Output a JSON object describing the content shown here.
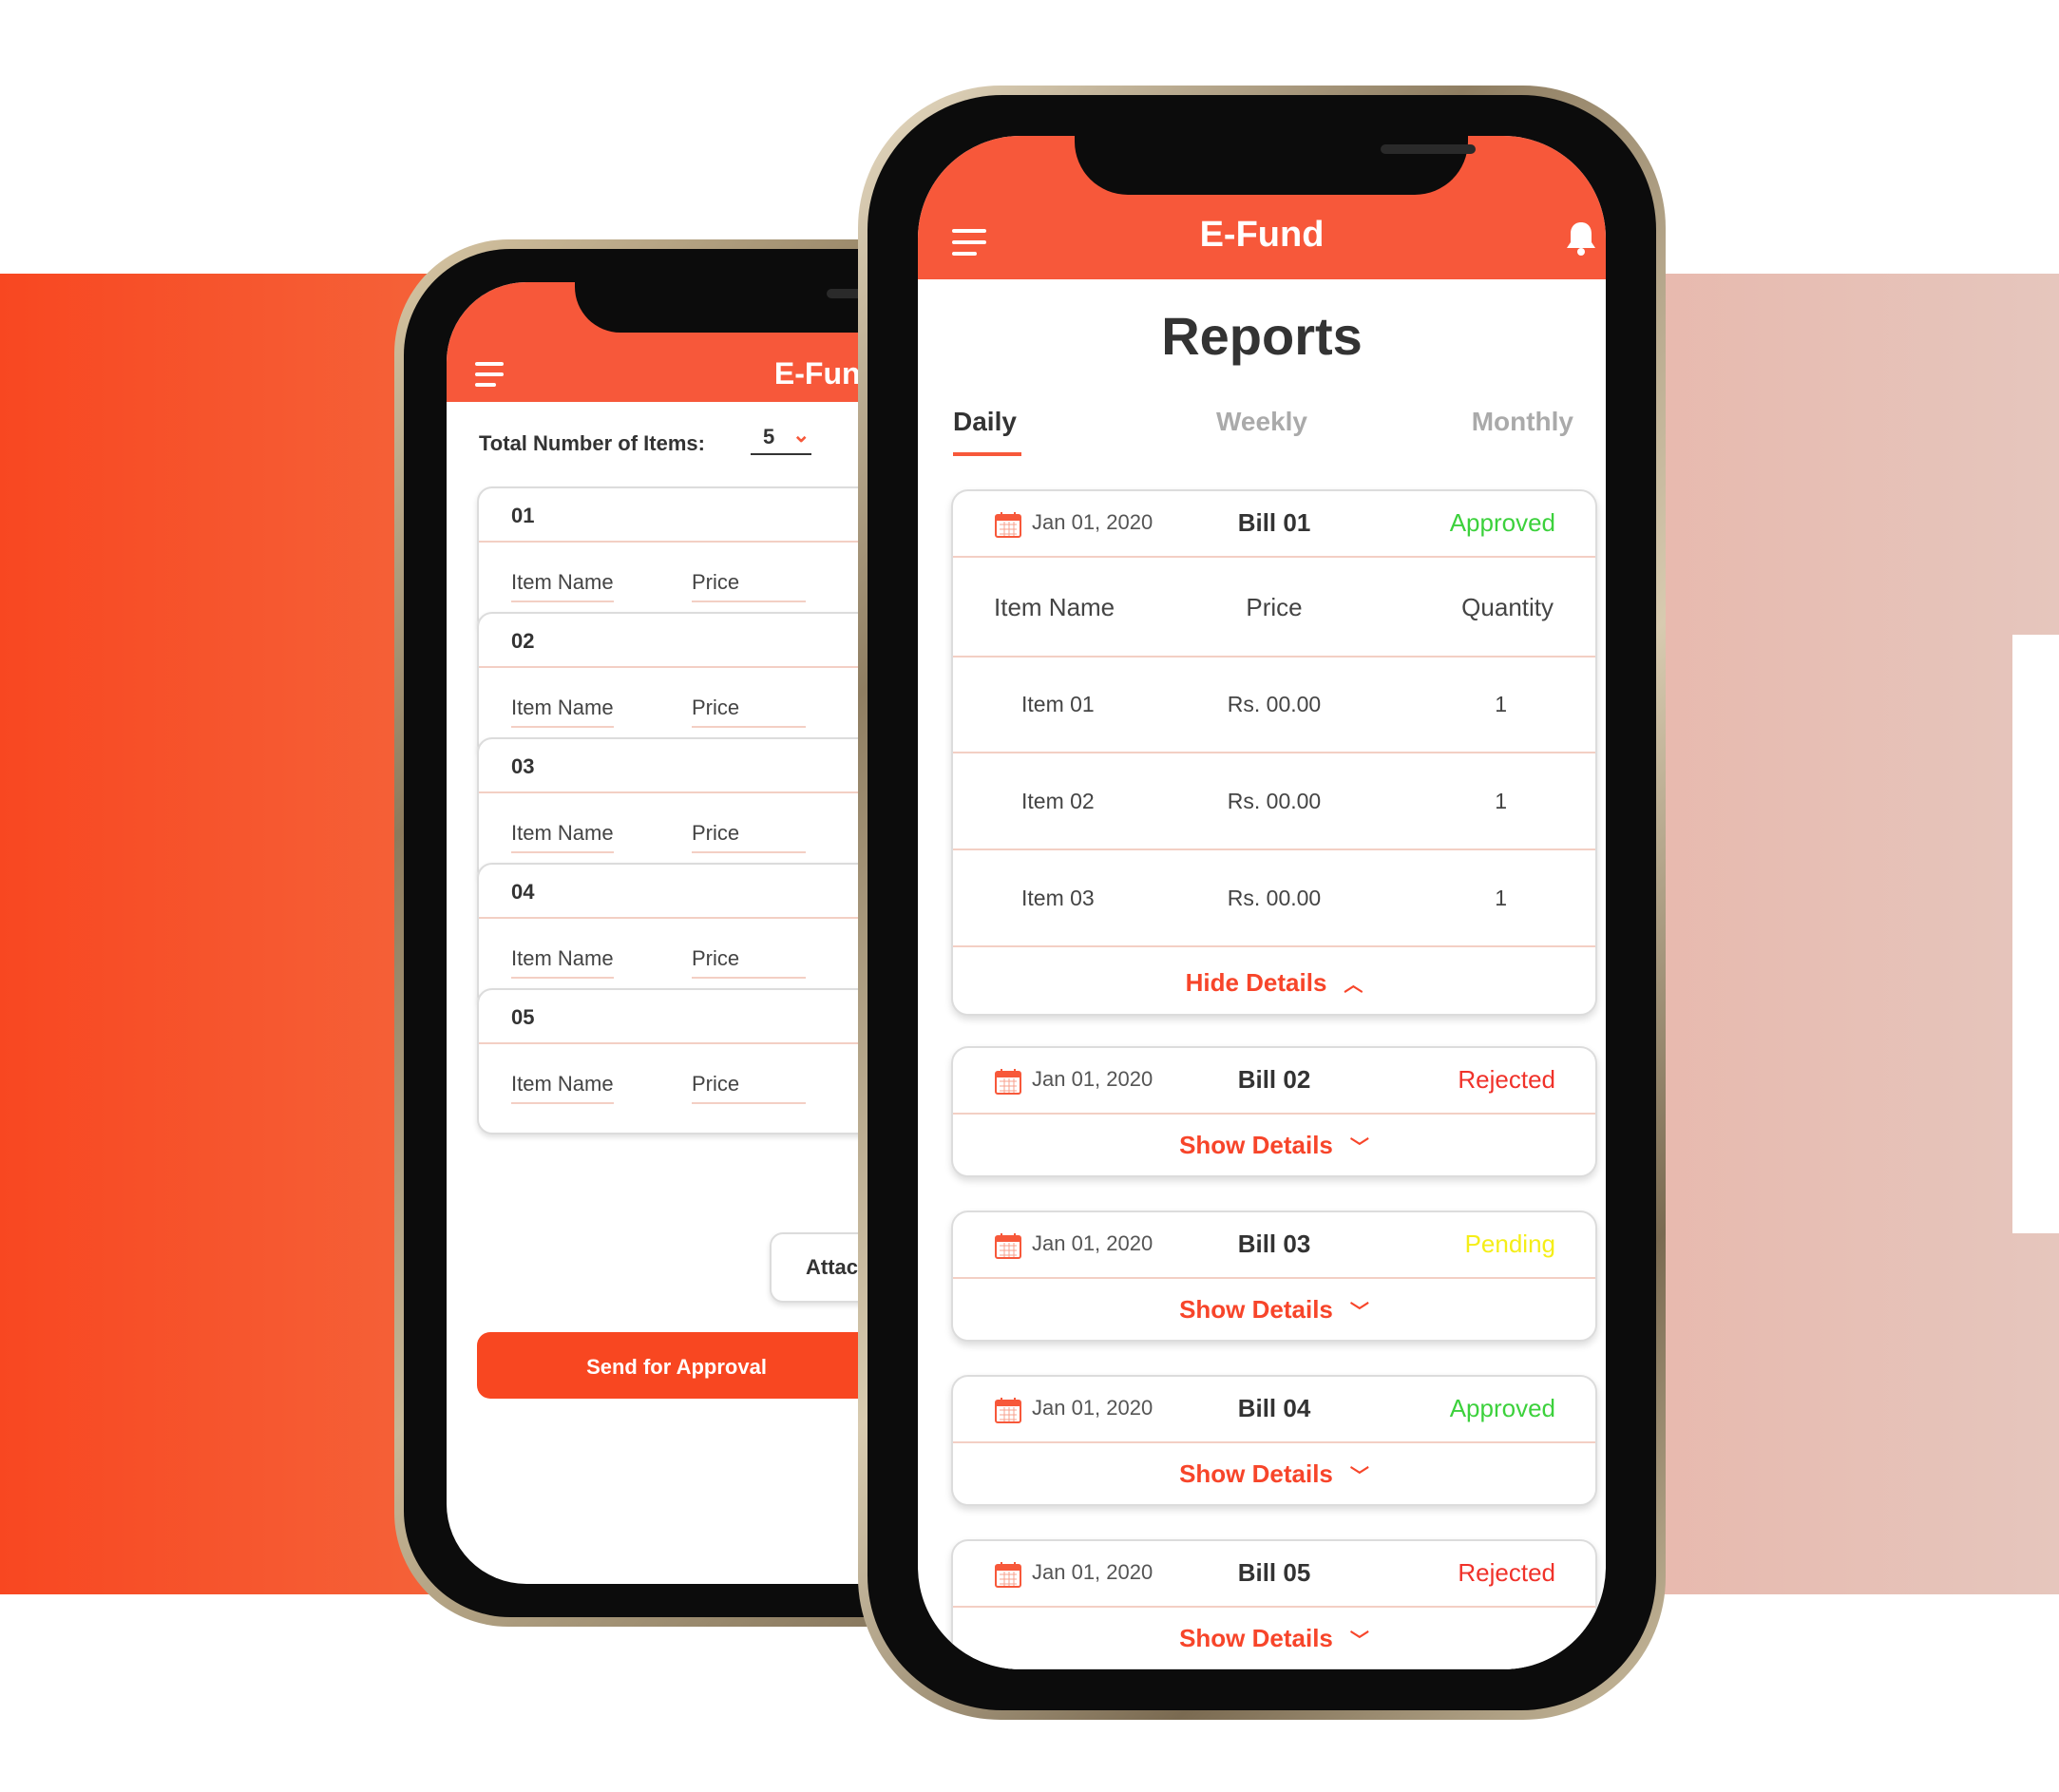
{
  "colors": {
    "brand": "#f7583a",
    "approved": "#3cd13c",
    "rejected": "#f0322a",
    "pending": "#f5ee18"
  },
  "back_phone": {
    "app_title": "E-Fund",
    "total_label": "Total Number of Items:",
    "total_value": "5",
    "items": [
      {
        "number": "01",
        "name_placeholder": "Item Name",
        "price_placeholder": "Price"
      },
      {
        "number": "02",
        "name_placeholder": "Item Name",
        "price_placeholder": "Price"
      },
      {
        "number": "03",
        "name_placeholder": "Item Name",
        "price_placeholder": "Price"
      },
      {
        "number": "04",
        "name_placeholder": "Item Name",
        "price_placeholder": "Price"
      },
      {
        "number": "05",
        "name_placeholder": "Item Name",
        "price_placeholder": "Price"
      }
    ],
    "attach_label": "Attac",
    "send_label": "Send for Approval"
  },
  "front_phone": {
    "app_title": "E-Fund",
    "page_title": "Reports",
    "tabs": {
      "daily": "Daily",
      "weekly": "Weekly",
      "monthly": "Monthly"
    },
    "bills": [
      {
        "date": "Jan 01, 2020",
        "name": "Bill 01",
        "status": "Approved",
        "headers": {
          "item": "Item Name",
          "price": "Price",
          "qty": "Quantity"
        },
        "rows": [
          {
            "item": "Item 01",
            "price": "Rs. 00.00",
            "qty": "1"
          },
          {
            "item": "Item 02",
            "price": "Rs. 00.00",
            "qty": "1"
          },
          {
            "item": "Item 03",
            "price": "Rs. 00.00",
            "qty": "1"
          }
        ],
        "toggle": "Hide Details"
      },
      {
        "date": "Jan 01, 2020",
        "name": "Bill 02",
        "status": "Rejected",
        "toggle": "Show Details"
      },
      {
        "date": "Jan 01, 2020",
        "name": "Bill 03",
        "status": "Pending",
        "toggle": "Show Details"
      },
      {
        "date": "Jan 01, 2020",
        "name": "Bill 04",
        "status": "Approved",
        "toggle": "Show Details"
      },
      {
        "date": "Jan 01, 2020",
        "name": "Bill 05",
        "status": "Rejected",
        "toggle": "Show Details"
      }
    ]
  }
}
